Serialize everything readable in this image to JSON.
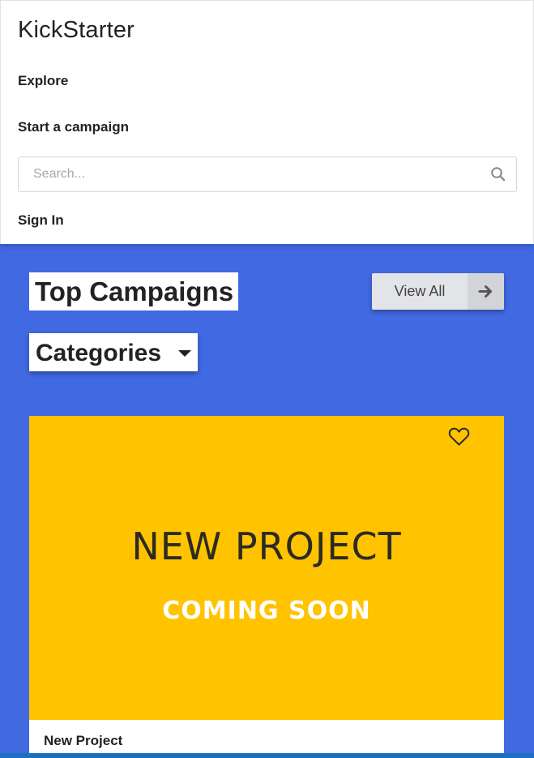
{
  "nav": {
    "brand": "KickStarter",
    "links": {
      "explore": "Explore",
      "start_campaign": "Start a campaign",
      "sign_in": "Sign In"
    },
    "search": {
      "placeholder": "Search...",
      "value": "",
      "icon": "search-icon"
    }
  },
  "main": {
    "background_color": "#4169e1",
    "title": "Top Campaigns",
    "view_all": {
      "label": "View All",
      "icon": "arrow-right-icon"
    },
    "categories": {
      "selected": "Categories",
      "icon": "chevron-down-icon"
    },
    "campaigns": [
      {
        "image_headline": "NEW PROJECT",
        "image_subline": "COMING SOON",
        "image_color": "#ffc300",
        "favorite_icon": "heart-icon",
        "title": "New Project"
      }
    ]
  }
}
